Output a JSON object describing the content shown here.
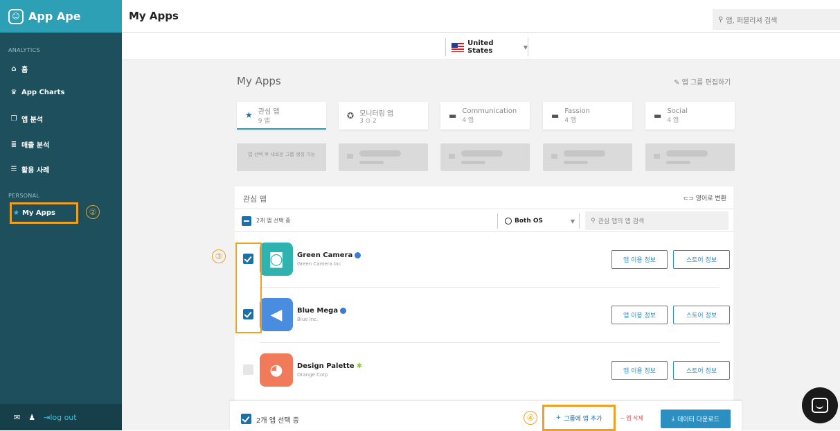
{
  "app": {
    "name": "App Ape",
    "logo_text": "☺"
  },
  "sidebar": {
    "analytics_label": "ANALYTICS",
    "items": [
      {
        "icon": "home-icon",
        "label": "홈"
      },
      {
        "icon": "trophy-icon",
        "label": "App Charts"
      },
      {
        "icon": "copy-icon",
        "label": "앱 분석"
      },
      {
        "icon": "database-icon",
        "label": "매출 분석"
      },
      {
        "icon": "list-icon",
        "label": "활용 사례"
      }
    ],
    "personal_label": "PERSONAL",
    "myapps_label": "My Apps",
    "myapps_annotation": "②",
    "logout_label": "log out"
  },
  "topbar": {
    "title": "My Apps",
    "search_placeholder": "앱, 퍼블리셔 검색"
  },
  "country": {
    "label": "United States"
  },
  "main": {
    "title": "My Apps",
    "edit_group": "앱 그룹 편집하기",
    "groups": [
      {
        "icon": "star-icon",
        "name": "관심 앱",
        "sub": "9 앱"
      },
      {
        "icon": "gamepad-icon",
        "name": "모니터링 앱",
        "sub": "3 ⊙ 2"
      },
      {
        "icon": "folder-icon",
        "name": "Communication",
        "sub": "4 앱"
      },
      {
        "icon": "folder-icon",
        "name": "Fassion",
        "sub": "4 앱"
      },
      {
        "icon": "folder-icon",
        "name": "Social",
        "sub": "4 앱"
      }
    ],
    "new_group_hint": "앱 선택 후 새로운 그룹 생성 가능"
  },
  "panel": {
    "title": "관심 앱",
    "english_toggle": "영어로 변환",
    "selected_count": "2개 앱 선택 중",
    "os_filter": "Both OS",
    "search_placeholder": "관심 앱의 앱 검색",
    "checkbox_annotation": "③",
    "apps": [
      {
        "name": "Green Camera",
        "publisher": "Green Camera Inc",
        "color": "#2fb3b0",
        "icon": "camera-icon",
        "selected": true,
        "platform": "ios",
        "btn1": "앱 이용 정보",
        "btn2": "스토어 정보"
      },
      {
        "name": "Blue Mega",
        "publisher": "Blue Inc.",
        "color": "#4a8de0",
        "icon": "megaphone-icon",
        "selected": true,
        "platform": "ios",
        "btn1": "앱 이용 정보",
        "btn2": "스토어 정보"
      },
      {
        "name": "Design Palette",
        "publisher": "Orange Corp",
        "color": "#f07a5a",
        "icon": "palette-icon",
        "selected": false,
        "platform": "android",
        "btn1": "앱 이용 정보",
        "btn2": "스토어 정보"
      }
    ]
  },
  "bottombar": {
    "selected_count": "2개 앱 선택 중",
    "add_group": "그룹에 앱 추가",
    "add_annotation": "④",
    "delete": "앱 삭제",
    "download": "데이터 다운로드"
  },
  "colors": {
    "accent": "#2da0b5",
    "sidebar": "#1d4f5c",
    "highlight": "#f0a020",
    "primary": "#2b8fc2"
  }
}
